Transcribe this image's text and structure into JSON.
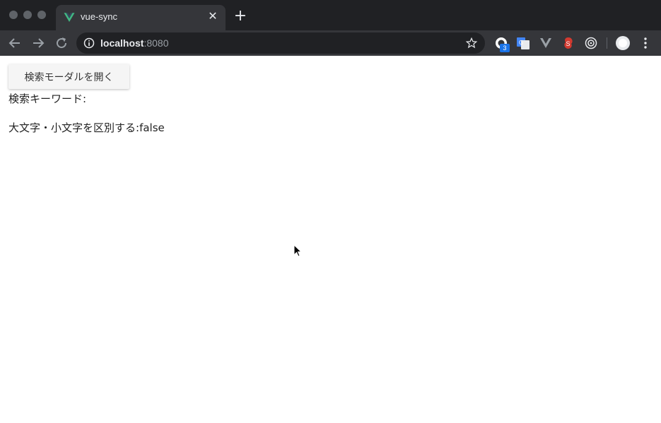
{
  "browser": {
    "tab_title": "vue-sync",
    "tab_close_icon": "close-icon",
    "new_tab_icon": "plus-icon",
    "url_host": "localhost",
    "url_port": ":8080",
    "extension_badge": "3",
    "colors": {
      "titlebar": "#202124",
      "toolbar": "#35363a",
      "vue_green": "#41b883",
      "badge_blue": "#1a73e8",
      "svelte_red": "#d33a30"
    }
  },
  "page": {
    "open_modal_button": "検索モーダルを開く",
    "keyword_label": "検索キーワード:",
    "keyword_value": "",
    "case_label": "大文字・小文字を区別する:",
    "case_value": "false"
  }
}
